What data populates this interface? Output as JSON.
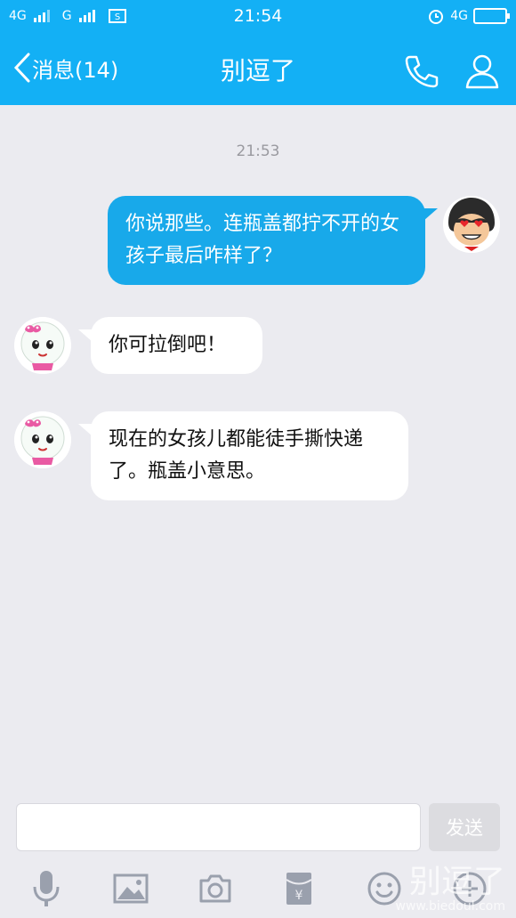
{
  "status_bar": {
    "network1": "4G",
    "network2": "G",
    "time": "21:54",
    "network3": "4G"
  },
  "nav": {
    "back_label": "消息(14)",
    "title": "别逗了"
  },
  "chat": {
    "timestamp": "21:53",
    "messages": [
      {
        "direction": "out",
        "text": "你说那些。连瓶盖都拧不开的女孩子最后咋样了？"
      },
      {
        "direction": "in",
        "text": "你可拉倒吧！"
      },
      {
        "direction": "in",
        "text": "现在的女孩儿都能徒手撕快递了。瓶盖小意思。"
      }
    ]
  },
  "composer": {
    "input_value": "",
    "send_label": "发送"
  },
  "toolbar": {
    "icons": [
      "microphone-icon",
      "image-icon",
      "camera-icon",
      "red-packet-icon",
      "emoji-icon",
      "plus-icon"
    ]
  },
  "watermark": {
    "text": "别逗了",
    "url": "www.biedoul.com"
  },
  "colors": {
    "accent": "#13b0f5",
    "outgoing_bubble": "#18a9ea",
    "background": "#ebebf0"
  }
}
